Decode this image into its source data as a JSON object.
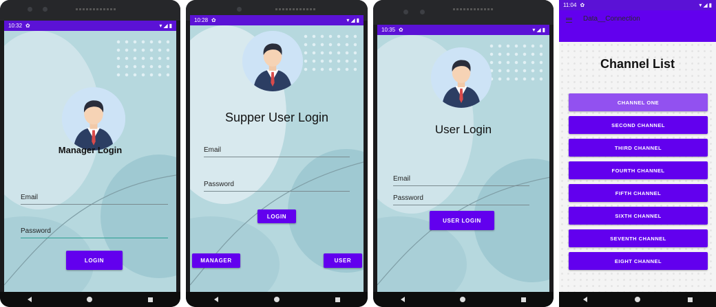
{
  "manager_screen": {
    "status_time": "10:32",
    "title": "Manager Login",
    "email_label": "Email",
    "password_label": "Password",
    "login_button": "LOGIN"
  },
  "super_screen": {
    "status_time": "10:28",
    "title": "Supper User Login",
    "email_label": "Email",
    "password_label": "Password",
    "login_button": "LOGIN",
    "manager_button": "MANAGER",
    "user_button": "USER"
  },
  "user_screen": {
    "status_time": "10:35",
    "title": "User  Login",
    "email_label": "Email",
    "password_label": "Password",
    "login_button": "USER LOGIN"
  },
  "channel_screen": {
    "status_time": "11:04",
    "app_title": "Data__Connection",
    "heading": "Channel List",
    "channels": [
      "CHANNEL ONE",
      "SECOND CHANNEL",
      "THIRD CHANNEL",
      "FOURTH CHANNEL",
      "FIFTH CHANNEL",
      "SIXTH CHANNEL",
      "SEVENTH CHANNEL",
      "EIGHT CHANNEL"
    ]
  },
  "colors": {
    "accent": "#6200ee",
    "status_bar": "#5b12d6",
    "background": "#b6d8de"
  },
  "icons": [
    "settings-icon",
    "wifi-icon",
    "signal-icon",
    "battery-icon",
    "menu-icon",
    "back-icon",
    "home-icon",
    "recents-icon",
    "avatar-icon"
  ]
}
